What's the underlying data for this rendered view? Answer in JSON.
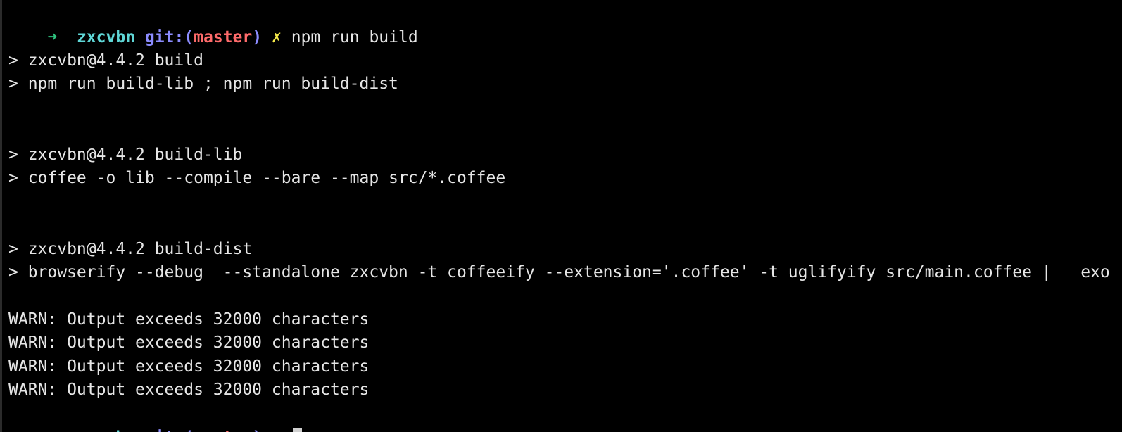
{
  "prompt": {
    "arrow": "➜",
    "directory": "zxcvbn",
    "git_prefix": "git:(",
    "branch": "master",
    "git_suffix": ")",
    "dirty_marker": "✗"
  },
  "command": "npm run build",
  "output_lines": [
    "> zxcvbn@4.4.2 build",
    "> npm run build-lib ; npm run build-dist",
    "> zxcvbn@4.4.2 build-lib",
    "> coffee -o lib --compile --bare --map src/*.coffee",
    "> zxcvbn@4.4.2 build-dist",
    "> browserify --debug  --standalone zxcvbn -t coffeeify --extension='.coffee' -t uglifyify src/main.coffee |   exo",
    "WARN: Output exceeds 32000 characters",
    "WARN: Output exceeds 32000 characters",
    "WARN: Output exceeds 32000 characters",
    "WARN: Output exceeds 32000 characters"
  ],
  "colors": {
    "background": "#000000",
    "text": "#e6e6e6",
    "arrow": "#2ec27e",
    "directory": "#5fd7d7",
    "git": "#8c8cff",
    "branch": "#ff6b6b",
    "dirty": "#f5e94a"
  }
}
